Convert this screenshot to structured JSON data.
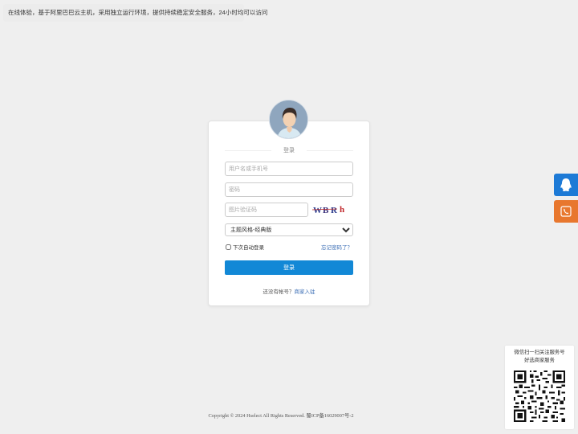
{
  "notice": "在线体验，基于阿里巴巴云主机，采用独立运行环境，提供持续稳定安全服务，24小时均可以访问",
  "login": {
    "title": "登录",
    "username_placeholder": "用户名或手机号",
    "password_placeholder": "密码",
    "captcha_placeholder": "图片验证码",
    "captcha_text": "WBRh",
    "theme_selected": "主题风格-经典版",
    "remember_label": "下次自动登录",
    "forgot_link": "忘记密码了？",
    "submit_label": "登录",
    "register_prompt": "还没有帐号？",
    "register_link": "商家入驻"
  },
  "floating": {
    "qq_icon": "qq-penguin-icon",
    "phone_icon": "phone-icon",
    "qq_color": "#1d7ad6",
    "phone_color": "#e8772e"
  },
  "qr": {
    "line1": "微信扫一扫关注服务号",
    "line2": "好选商家服务"
  },
  "footer": "Copyright © 2024 Hselect All Rights Reserved. 蜀ICP备16029007号-2",
  "colors": {
    "primary": "#1288d6",
    "link": "#3b6eb5",
    "background": "#efefef"
  }
}
